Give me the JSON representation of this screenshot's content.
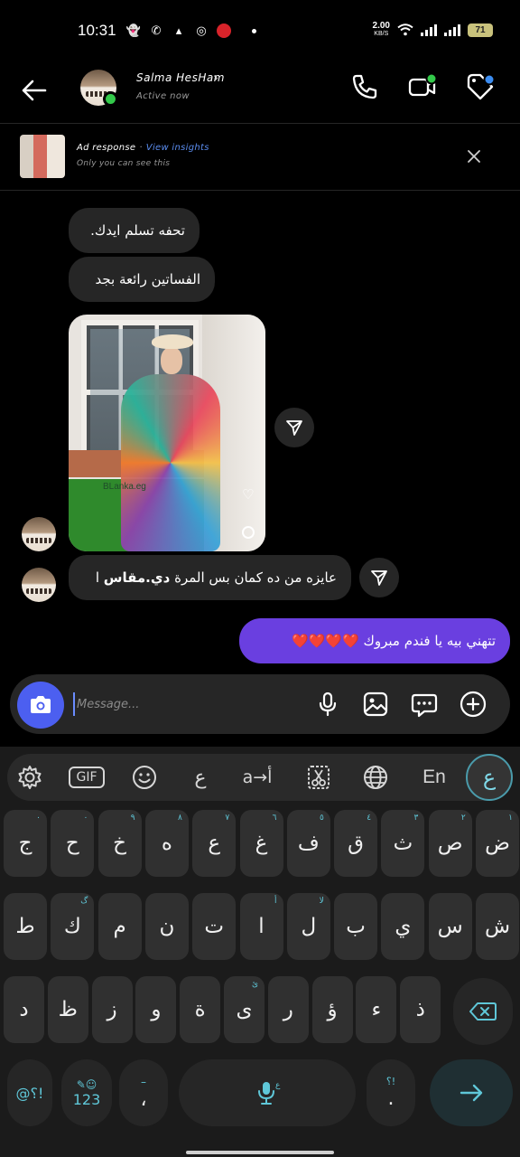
{
  "status_bar": {
    "time": "10:31",
    "net_speed": "2.00",
    "net_unit": "KB/S",
    "battery": "71"
  },
  "header": {
    "name": "Salma HesHam",
    "status": "Active now"
  },
  "ad": {
    "title": "Ad response",
    "separator": "·",
    "link": "View insights",
    "subtitle": "Only you can see this"
  },
  "messages": {
    "m1": "تحفه تسلم ايدك.",
    "m2": "الفساتين رائعة بجد",
    "photo_watermark": "BLanka.eg",
    "m4_part1": "عايزه من ده كمان بس المرة ",
    "m4_bold": "دي.مقاس",
    "m4_part2": " ا",
    "m5": "تتهني بيه يا فندم مبروك ❤️❤️❤️❤️"
  },
  "composer": {
    "placeholder": "Message..."
  },
  "keyboard": {
    "toolbar": {
      "gif": "GIF",
      "lang_glyph": "ع",
      "translit": "a→أ",
      "en": "En",
      "arabic": "ع"
    },
    "row1": [
      {
        "k": "ض",
        "h": "١"
      },
      {
        "k": "ص",
        "h": "٢"
      },
      {
        "k": "ث",
        "h": "٣"
      },
      {
        "k": "ق",
        "h": "٤"
      },
      {
        "k": "ف",
        "h": "٥"
      },
      {
        "k": "غ",
        "h": "٦"
      },
      {
        "k": "ع",
        "h": "٧"
      },
      {
        "k": "ه",
        "h": "٨"
      },
      {
        "k": "خ",
        "h": "٩"
      },
      {
        "k": "ح",
        "h": "٠"
      },
      {
        "k": "ج",
        "h": "٠"
      }
    ],
    "row2": [
      {
        "k": "ش",
        "h": ""
      },
      {
        "k": "س",
        "h": ""
      },
      {
        "k": "ي",
        "h": ""
      },
      {
        "k": "ب",
        "h": ""
      },
      {
        "k": "ل",
        "h": "لا"
      },
      {
        "k": "ا",
        "h": "أ"
      },
      {
        "k": "ت",
        "h": ""
      },
      {
        "k": "ن",
        "h": ""
      },
      {
        "k": "م",
        "h": ""
      },
      {
        "k": "ك",
        "h": "گ"
      },
      {
        "k": "ط",
        "h": ""
      }
    ],
    "row3": [
      {
        "k": "ذ",
        "h": ""
      },
      {
        "k": "ء",
        "h": ""
      },
      {
        "k": "ؤ",
        "h": ""
      },
      {
        "k": "ر",
        "h": ""
      },
      {
        "k": "ى",
        "h": "ئ"
      },
      {
        "k": "ة",
        "h": ""
      },
      {
        "k": "و",
        "h": ""
      },
      {
        "k": "ز",
        "h": ""
      },
      {
        "k": "ظ",
        "h": ""
      },
      {
        "k": "د",
        "h": ""
      }
    ],
    "symbols": "@؟!",
    "numbers": "123",
    "comma": "،",
    "period": "."
  }
}
